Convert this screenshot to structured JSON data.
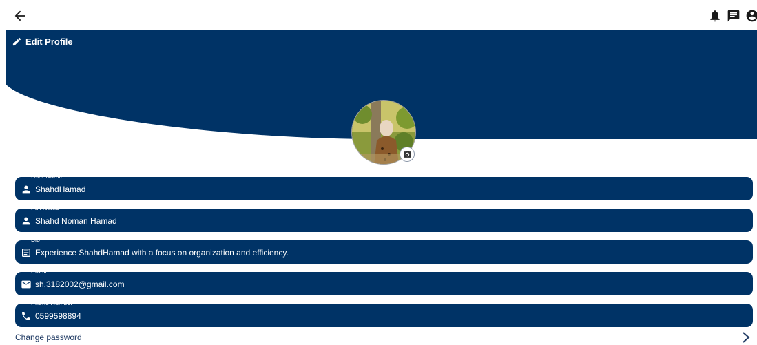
{
  "header": {
    "back_icon": "arrow-left-icon",
    "icons": [
      "bell-icon",
      "chat-icon",
      "account-circle-icon"
    ]
  },
  "banner": {
    "title": "Edit Profile",
    "title_icon": "pencil-icon",
    "color": "#003366"
  },
  "avatar": {
    "alt": "Profile photo",
    "camera_icon": "camera-icon"
  },
  "fields": [
    {
      "label": "User Name",
      "value": "ShahdHamad",
      "icon": "person-icon"
    },
    {
      "label": "Full Name",
      "value": "Shahd Noman Hamad",
      "icon": "person-icon"
    },
    {
      "label": "Bio",
      "value": "Experience ShahdHamad with a focus on organization and efficiency.",
      "icon": "article-icon"
    },
    {
      "label": "Email",
      "value": "sh.3182002@gmail.com",
      "icon": "email-icon"
    },
    {
      "label": "Phone Number",
      "value": "0599598894",
      "icon": "phone-icon"
    }
  ],
  "change_password": {
    "label": "Change password",
    "icon": "chevron-right-icon"
  }
}
